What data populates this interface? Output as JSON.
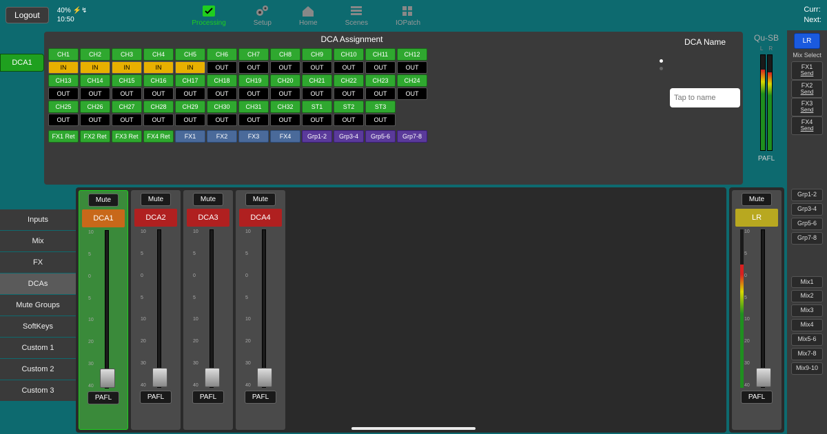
{
  "topbar": {
    "logout": "Logout",
    "battery": "40%",
    "time": "10:50",
    "nav": {
      "processing": "Processing",
      "setup": "Setup",
      "home": "Home",
      "scenes": "Scenes",
      "iopatch": "IOPatch"
    },
    "curr_label": "Curr:",
    "next_label": "Next:"
  },
  "left_tab": {
    "dca1": "DCA1"
  },
  "assignment": {
    "title": "DCA Assignment",
    "name_title": "DCA Name",
    "name_placeholder": "Tap to name",
    "rows": [
      [
        {
          "label": "CH1",
          "state": "IN"
        },
        {
          "label": "CH2",
          "state": "IN"
        },
        {
          "label": "CH3",
          "state": "IN"
        },
        {
          "label": "CH4",
          "state": "IN"
        },
        {
          "label": "CH5",
          "state": "IN"
        },
        {
          "label": "CH6",
          "state": "OUT"
        },
        {
          "label": "CH7",
          "state": "OUT"
        },
        {
          "label": "CH8",
          "state": "OUT"
        },
        {
          "label": "CH9",
          "state": "OUT"
        },
        {
          "label": "CH10",
          "state": "OUT"
        },
        {
          "label": "CH11",
          "state": "OUT"
        },
        {
          "label": "CH12",
          "state": "OUT"
        }
      ],
      [
        {
          "label": "CH13",
          "state": "OUT"
        },
        {
          "label": "CH14",
          "state": "OUT"
        },
        {
          "label": "CH15",
          "state": "OUT"
        },
        {
          "label": "CH16",
          "state": "OUT"
        },
        {
          "label": "CH17",
          "state": "OUT"
        },
        {
          "label": "CH18",
          "state": "OUT"
        },
        {
          "label": "CH19",
          "state": "OUT"
        },
        {
          "label": "CH20",
          "state": "OUT"
        },
        {
          "label": "CH21",
          "state": "OUT"
        },
        {
          "label": "CH22",
          "state": "OUT"
        },
        {
          "label": "CH23",
          "state": "OUT"
        },
        {
          "label": "CH24",
          "state": "OUT"
        }
      ],
      [
        {
          "label": "CH25",
          "state": "OUT"
        },
        {
          "label": "CH26",
          "state": "OUT"
        },
        {
          "label": "CH27",
          "state": "OUT"
        },
        {
          "label": "CH28",
          "state": "OUT"
        },
        {
          "label": "CH29",
          "state": "OUT"
        },
        {
          "label": "CH30",
          "state": "OUT"
        },
        {
          "label": "CH31",
          "state": "OUT"
        },
        {
          "label": "CH32",
          "state": "OUT"
        },
        {
          "label": "ST1",
          "state": "OUT"
        },
        {
          "label": "ST2",
          "state": "OUT"
        },
        {
          "label": "ST3",
          "state": "OUT"
        }
      ]
    ],
    "fx_row": [
      {
        "label": "FX1 Ret",
        "cls": "fx-green"
      },
      {
        "label": "FX2 Ret",
        "cls": "fx-green"
      },
      {
        "label": "FX3 Ret",
        "cls": "fx-green"
      },
      {
        "label": "FX4 Ret",
        "cls": "fx-green"
      },
      {
        "label": "FX1",
        "cls": "fx-blue"
      },
      {
        "label": "FX2",
        "cls": "fx-blue"
      },
      {
        "label": "FX3",
        "cls": "fx-blue"
      },
      {
        "label": "FX4",
        "cls": "fx-blue"
      },
      {
        "label": "Grp1-2",
        "cls": "fx-purple"
      },
      {
        "label": "Grp3-4",
        "cls": "fx-purple"
      },
      {
        "label": "Grp5-6",
        "cls": "fx-purple"
      },
      {
        "label": "Grp7-8",
        "cls": "fx-purple"
      }
    ]
  },
  "meter": {
    "brand": "Qu-SB",
    "l": "L",
    "r": "R",
    "pafl": "PAFL",
    "level_l": 85,
    "level_r": 82
  },
  "mix_select": {
    "lr": "LR",
    "label": "Mix Select",
    "fx": [
      {
        "t": "FX1",
        "s": "Send"
      },
      {
        "t": "FX2",
        "s": "Send"
      },
      {
        "t": "FX3",
        "s": "Send"
      },
      {
        "t": "FX4",
        "s": "Send"
      }
    ],
    "grp": [
      "Grp1-2",
      "Grp3-4",
      "Grp5-6",
      "Grp7-8"
    ],
    "mix": [
      "Mix1",
      "Mix2",
      "Mix3",
      "Mix4",
      "Mix5-6",
      "Mix7-8",
      "Mix9-10"
    ]
  },
  "sidebar": {
    "items": [
      "Inputs",
      "Mix",
      "FX",
      "DCAs",
      "Mute Groups",
      "SoftKeys",
      "Custom 1",
      "Custom 2",
      "Custom 3"
    ],
    "active": 3
  },
  "faders": {
    "mute": "Mute",
    "pafl": "PAFL",
    "scale": [
      "10",
      "5",
      "0",
      "5",
      "10",
      "20",
      "30",
      "40"
    ],
    "strips": [
      {
        "name": "DCA1",
        "color": "orange",
        "selected": true,
        "pos": 200
      },
      {
        "name": "DCA2",
        "color": "red",
        "selected": false,
        "pos": 200
      },
      {
        "name": "DCA3",
        "color": "red",
        "selected": false,
        "pos": 200
      },
      {
        "name": "DCA4",
        "color": "red",
        "selected": false,
        "pos": 200
      }
    ],
    "lr_strip": {
      "name": "LR",
      "color": "yellow",
      "pos": 200,
      "meter": 78
    }
  }
}
